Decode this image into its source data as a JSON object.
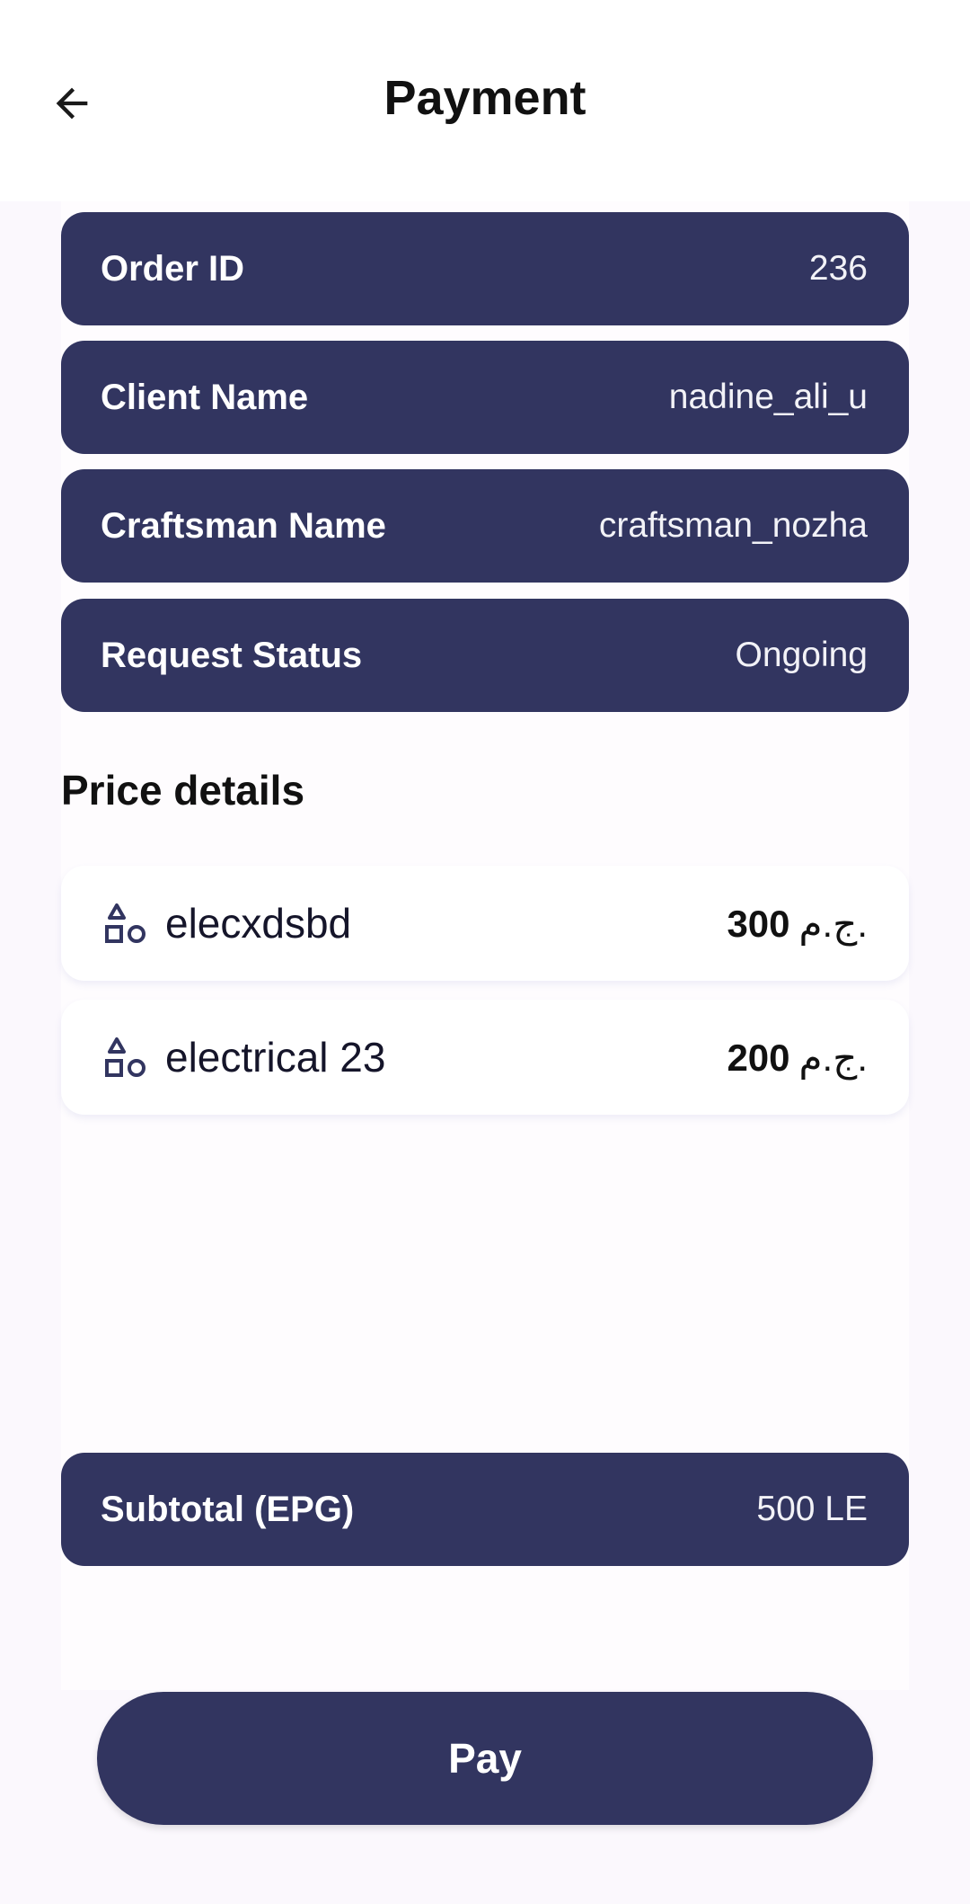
{
  "header": {
    "title": "Payment",
    "back_icon": "arrow-left-icon"
  },
  "info": {
    "order_id": {
      "label": "Order ID",
      "value": "236"
    },
    "client_name": {
      "label": "Client Name",
      "value": "nadine_ali_u"
    },
    "craftsman_name": {
      "label": "Craftsman Name",
      "value": "craftsman_nozha"
    },
    "request_status": {
      "label": "Request Status",
      "value": "Ongoing"
    }
  },
  "price_details": {
    "title": "Price details",
    "items": [
      {
        "name": "elecxdsbd",
        "amount": "300",
        "currency": "ج.م.",
        "icon": "shapes-icon"
      },
      {
        "name": "electrical 23",
        "amount": "200",
        "currency": "ج.م.",
        "icon": "shapes-icon"
      }
    ]
  },
  "subtotal": {
    "label": "Subtotal (EPG)",
    "value": "500 LE"
  },
  "pay_button": {
    "label": "Pay"
  },
  "colors": {
    "primary": "#323560",
    "background": "#fbf8fd",
    "card": "#ffffff"
  }
}
